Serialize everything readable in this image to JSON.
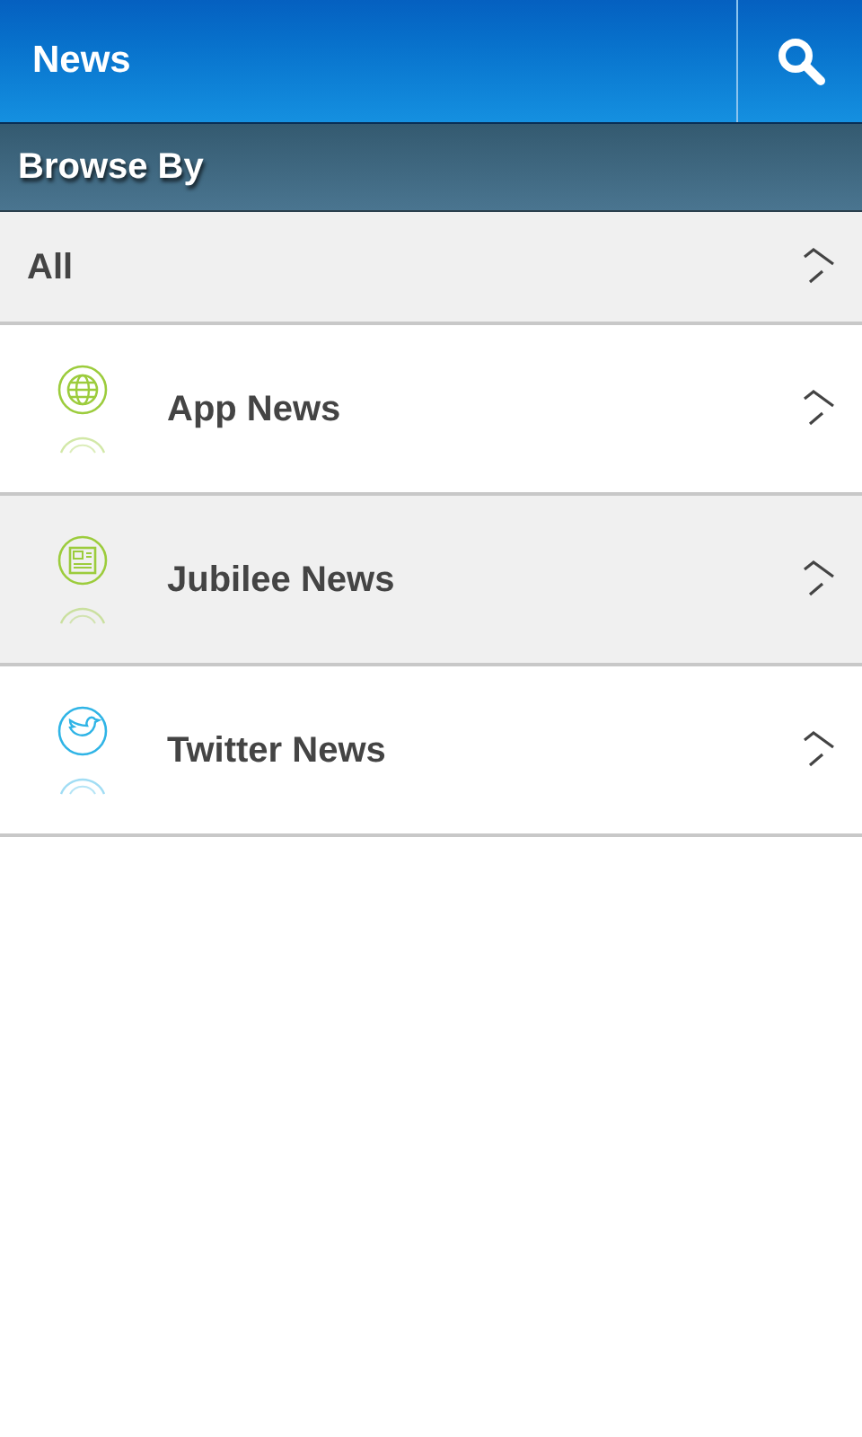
{
  "header": {
    "title": "News"
  },
  "section_header": "Browse By",
  "all_row": {
    "label": "All"
  },
  "items": [
    {
      "label": "App News",
      "kind": "globe"
    },
    {
      "label": "Jubilee News",
      "kind": "newspaper"
    },
    {
      "label": "Twitter News",
      "kind": "bird"
    }
  ]
}
